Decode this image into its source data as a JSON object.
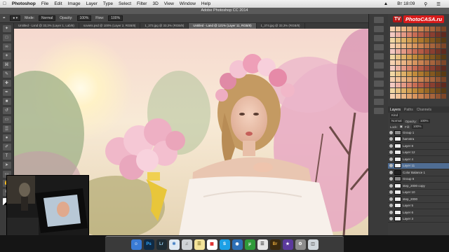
{
  "menubar": {
    "app": "Photoshop",
    "items": [
      "File",
      "Edit",
      "Image",
      "Layer",
      "Type",
      "Select",
      "Filter",
      "3D",
      "View",
      "Window",
      "Help"
    ],
    "clock": "Вт 18:09"
  },
  "window_title": "Adobe Photoshop CC 2014",
  "options": {
    "mode_label": "Mode:",
    "mode_value": "Normal",
    "opacity_label": "Opacity:",
    "opacity_value": "100%",
    "flow_label": "Flow:",
    "flow_value": "100%"
  },
  "tabs": [
    {
      "label": "Untitled - Lxnd @ 33,3% (Layer 1, Lab/8)",
      "active": false
    },
    {
      "label": "soviets.psd @ 100% (Layer 2, RGB/8)",
      "active": false
    },
    {
      "label": "1_373.jpg @ 33,3% (RGB/8)",
      "active": false
    },
    {
      "label": "Untitled - Land @ 121% (Layer 11, RGB/8)",
      "active": true
    },
    {
      "label": "1_374.jpg @ 33,3% (RGB/8)",
      "active": false
    }
  ],
  "brand": {
    "tv": "TV",
    "photo": "Photo",
    "casa": "CASA.ru"
  },
  "layers_panel": {
    "tabs": [
      "Layers",
      "Paths",
      "Channels"
    ],
    "kind_label": "Kind",
    "blend_value": "Normal",
    "opacity_label": "Opacity:",
    "opacity_value": "100%",
    "lock_label": "Lock:",
    "fill_label": "Fill:",
    "fill_value": "100%",
    "layers": [
      {
        "name": "Group 1",
        "type": "group",
        "selected": false
      },
      {
        "name": "hamstra",
        "type": "layer",
        "selected": false
      },
      {
        "name": "Layer 8",
        "type": "layer",
        "selected": false
      },
      {
        "name": "Layer 12",
        "type": "layer",
        "selected": false
      },
      {
        "name": "Layer 4",
        "type": "layer",
        "selected": false
      },
      {
        "name": "Layer 11",
        "type": "layer",
        "selected": true
      },
      {
        "name": "Color Balance 1",
        "type": "adjust",
        "selected": false
      },
      {
        "name": "Group 6",
        "type": "group",
        "selected": false
      },
      {
        "name": "step_2000 copy",
        "type": "layer",
        "selected": false
      },
      {
        "name": "Layer 10",
        "type": "layer",
        "selected": false
      },
      {
        "name": "step_2000",
        "type": "layer",
        "selected": false
      },
      {
        "name": "Layer 5",
        "type": "layer",
        "selected": false
      },
      {
        "name": "Layer 6",
        "type": "layer",
        "selected": false
      },
      {
        "name": "Layer 3",
        "type": "layer",
        "selected": false
      }
    ]
  },
  "dock_icons": [
    "finder-icon",
    "photoshop-icon",
    "lightroom-icon",
    "safari-icon",
    "itunes-icon",
    "notes-icon",
    "calendar-icon",
    "skype-icon",
    "photos-icon",
    "utorrent-icon",
    "app-store-icon",
    "bridge-icon",
    "imovie-icon",
    "system-preferences-icon",
    "trash-icon"
  ],
  "dock_labels": {
    "photoshop": "Ps",
    "lightroom": "Lr",
    "bridge": "Br",
    "skype": "S"
  },
  "colors": {
    "accent_selected": "#4f6d93",
    "brand_red": "#d81b1b",
    "canvas_sky": "#f7e8d2",
    "blossom_pink": "#e7a9c3"
  }
}
